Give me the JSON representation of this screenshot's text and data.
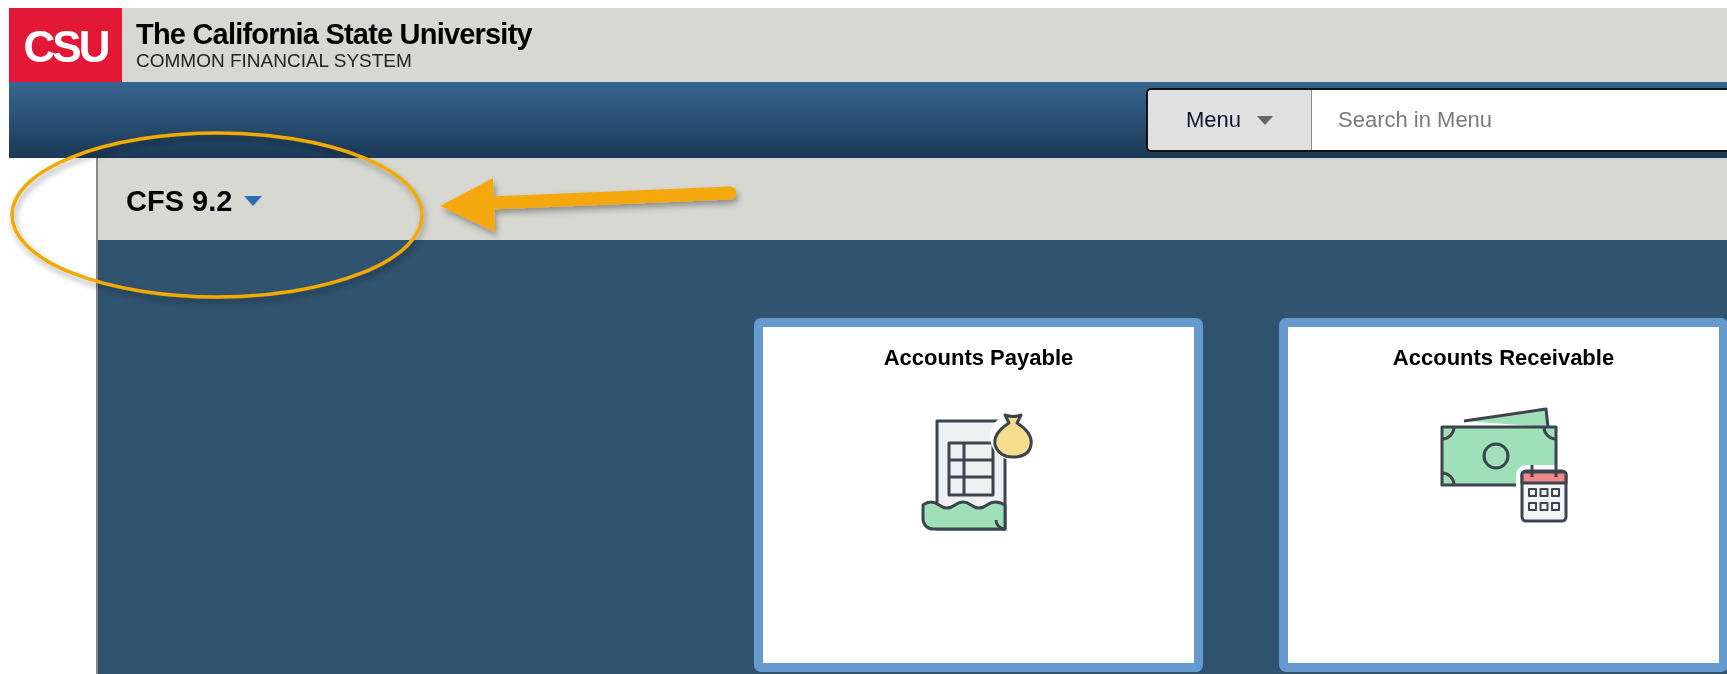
{
  "logo": {
    "text": "CSU"
  },
  "header": {
    "title": "The California State University",
    "subtitle": "COMMON FINANCIAL SYSTEM"
  },
  "nav": {
    "menu_button": "Menu",
    "search": {
      "placeholder": "Search in Menu"
    }
  },
  "homepage_selector": {
    "label": "CFS 9.2"
  },
  "tiles": [
    {
      "title": "Accounts Payable",
      "kind": "payable"
    },
    {
      "title": "Accounts Receivable",
      "kind": "receivable"
    }
  ]
}
